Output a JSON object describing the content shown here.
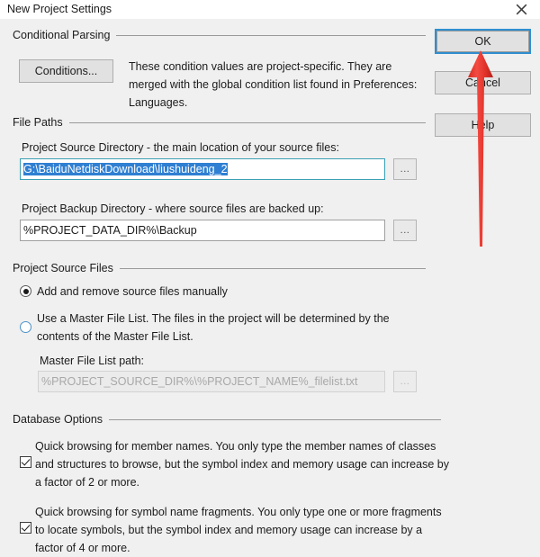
{
  "window": {
    "title": "New Project Settings",
    "close_icon": "close-icon"
  },
  "groups": {
    "conditional_parsing": "Conditional Parsing",
    "file_paths": "File Paths",
    "project_source_files": "Project Source Files",
    "database_options": "Database Options"
  },
  "conditional_parsing": {
    "conditions_button": "Conditions...",
    "description": "These condition values are project-specific.  They are merged with the global condition list found in Preferences: Languages."
  },
  "file_paths": {
    "source_dir_label": "Project Source Directory - the main location of your source files:",
    "source_dir_value": "G:\\BaiduNetdiskDownload\\liushuideng_2",
    "source_dir_browse": "...",
    "backup_dir_label": "Project Backup Directory - where source files are backed up:",
    "backup_dir_value": "%PROJECT_DATA_DIR%\\Backup",
    "backup_dir_browse": "..."
  },
  "project_source_files": {
    "radio_manual_label": "Add and remove source files manually",
    "radio_master_label": "Use a Master File List. The files in the project will be determined by the contents of the Master File List.",
    "master_path_label": "Master File List path:",
    "master_path_value": "%PROJECT_SOURCE_DIR%\\%PROJECT_NAME%_filelist.txt",
    "master_path_browse": "..."
  },
  "database_options": {
    "member_names_label": "Quick browsing for member names.  You only type the member names of classes and structures to browse, but the symbol index and memory usage can increase by a factor of 2 or more.",
    "fragments_label": "Quick browsing for symbol name fragments.  You only type one or more fragments to locate symbols, but the symbol index and memory usage can increase by a factor of 4 or more."
  },
  "buttons": {
    "ok": "OK",
    "cancel": "Cancel",
    "help": "Help"
  },
  "colors": {
    "focus_blue": "#2f8fd0",
    "selection_blue": "#2f7fd2",
    "annotation_red": "#e8312a",
    "dialog_bg": "#f0f0f0"
  }
}
